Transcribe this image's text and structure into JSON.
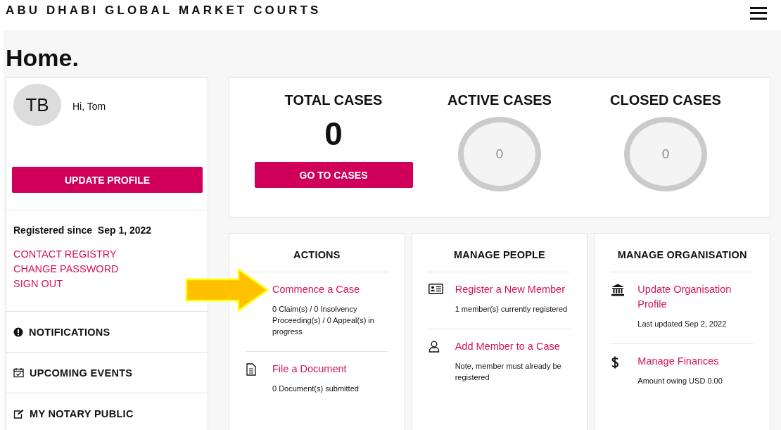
{
  "header": {
    "title": "ABU DHABI GLOBAL MARKET COURTS"
  },
  "page_title": "Home.",
  "profile": {
    "initials": "TB",
    "greeting": "Hi, Tom",
    "button": "UPDATE PROFILE"
  },
  "account": {
    "registered": "Registered since  Sep 1, 2022",
    "links": [
      "CONTACT REGISTRY",
      "CHANGE PASSWORD",
      "SIGN OUT"
    ]
  },
  "sections": [
    {
      "kind": "alert",
      "label": "NOTIFICATIONS"
    },
    {
      "kind": "calendar",
      "label": "UPCOMING EVENTS"
    },
    {
      "kind": "edit",
      "label": "MY NOTARY PUBLIC"
    }
  ],
  "stats": [
    {
      "kind": "number",
      "title": "TOTAL CASES",
      "value": "0",
      "button": "GO TO CASES"
    },
    {
      "kind": "ring",
      "title": "ACTIVE CASES",
      "value": "0"
    },
    {
      "kind": "ring",
      "title": "CLOSED CASES",
      "value": "0"
    }
  ],
  "cards": [
    {
      "title": "ACTIONS",
      "items": [
        {
          "kind": "plain",
          "link": "Commence a Case",
          "note": "0 Claim(s) / 0 Insolvency Proceeding(s) / 0 Appeal(s) in progress",
          "highlighted": true
        },
        {
          "kind": "document",
          "link": "File a Document",
          "note": "0 Document(s) submitted",
          "highlighted": false
        }
      ]
    },
    {
      "title": "MANAGE PEOPLE",
      "items": [
        {
          "kind": "id-card",
          "link": "Register a New Member",
          "note": "1 member(s) currently registered",
          "highlighted": false
        },
        {
          "kind": "person",
          "link": "Add Member to a Case",
          "note": "Note, member must already be registered",
          "highlighted": false
        }
      ]
    },
    {
      "title": "MANAGE ORGANISATION",
      "items": [
        {
          "kind": "bank",
          "link": "Update Organisation Profile",
          "note": "Last updated Sep 2, 2022",
          "highlighted": false
        },
        {
          "kind": "dollar",
          "link": "Manage Finances",
          "note": "Amount owing USD 0.00",
          "highlighted": false
        }
      ]
    }
  ]
}
